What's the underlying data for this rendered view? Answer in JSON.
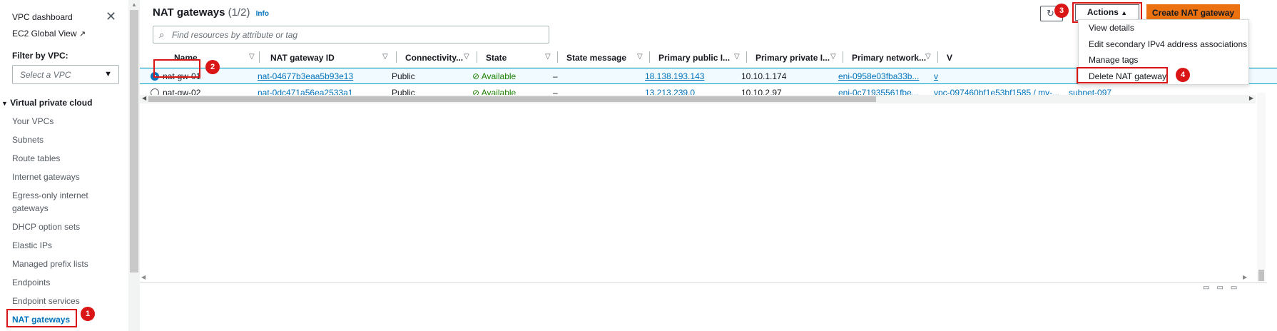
{
  "sidebar": {
    "vpc_dashboard": "VPC dashboard",
    "ec2_global_view": "EC2 Global View",
    "filter_label": "Filter by VPC:",
    "filter_placeholder": "Select a VPC",
    "section": "Virtual private cloud",
    "items": [
      {
        "label": "Your VPCs"
      },
      {
        "label": "Subnets"
      },
      {
        "label": "Route tables"
      },
      {
        "label": "Internet gateways"
      },
      {
        "label": "Egress-only internet"
      },
      {
        "label": "gateways"
      },
      {
        "label": "DHCP option sets"
      },
      {
        "label": "Elastic IPs"
      },
      {
        "label": "Managed prefix lists"
      },
      {
        "label": "Endpoints"
      },
      {
        "label": "Endpoint services"
      },
      {
        "label": "NAT gateways"
      }
    ]
  },
  "header": {
    "title": "NAT gateways",
    "count": "(1/2)",
    "info": "Info",
    "search_placeholder": "Find resources by attribute or tag",
    "actions_label": "Actions",
    "create_label": "Create NAT gateway"
  },
  "table": {
    "columns": [
      "Name",
      "NAT gateway ID",
      "Connectivity...",
      "State",
      "State message",
      "Primary public I...",
      "Primary private I...",
      "Primary network...",
      "V"
    ],
    "rows": [
      {
        "name": "nat-gw-01",
        "id": "nat-04677b3eaa5b93e13",
        "connectivity": "Public",
        "state": "Available",
        "message": "–",
        "public_ip": "18.138.193.143",
        "private_ip": "10.10.1.174",
        "network": "eni-0958e03fba33b...",
        "vpc": "v",
        "selected": true
      },
      {
        "name": "nat-gw-02",
        "id": "nat-0dc471a56ea2533a1",
        "connectivity": "Public",
        "state": "Available",
        "message": "–",
        "public_ip": "13.213.239.0",
        "private_ip": "10.10.2.97",
        "network": "eni-0c71935561fbe...",
        "vpc": "vpc-097460bf1e53bf1585 / my-...",
        "subnet": "subnet-097",
        "selected": false
      }
    ]
  },
  "actions_menu": {
    "items": [
      "View details",
      "Edit secondary IPv4 address associations",
      "Manage tags",
      "Delete NAT gateway"
    ]
  },
  "annotations": {
    "b1": "1",
    "b2": "2",
    "b3": "3",
    "b4": "4"
  },
  "colors": {
    "accent": "#0073bb",
    "primary_button": "#ec7211",
    "highlight": "#d91515",
    "available": "#1d8102"
  }
}
